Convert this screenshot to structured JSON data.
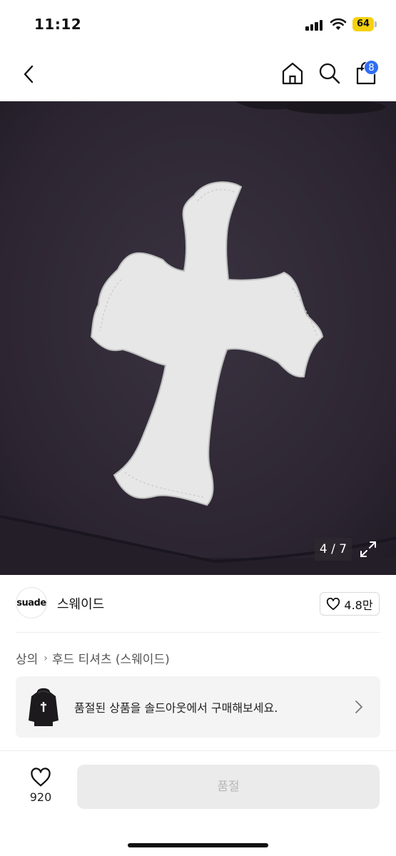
{
  "status_bar": {
    "time": "11:12",
    "battery": "64"
  },
  "nav": {
    "cart_count": "8"
  },
  "gallery": {
    "counter": "4 / 7"
  },
  "brand": {
    "logo_text": "suade",
    "name": "스웨이드",
    "likes": "4.8만"
  },
  "breadcrumb": {
    "category": "상의",
    "subcategory": "후드 티셔츠 (스웨이드)"
  },
  "soldout_banner": {
    "message": "품절된 상품을 솔드아웃에서 구매해보세요."
  },
  "bottom_bar": {
    "wish_count": "920",
    "buy_label": "품절"
  },
  "colors": {
    "accent_badge": "#2f6df5",
    "battery": "#f6d10f",
    "disabled_button": "#ebebeb"
  }
}
